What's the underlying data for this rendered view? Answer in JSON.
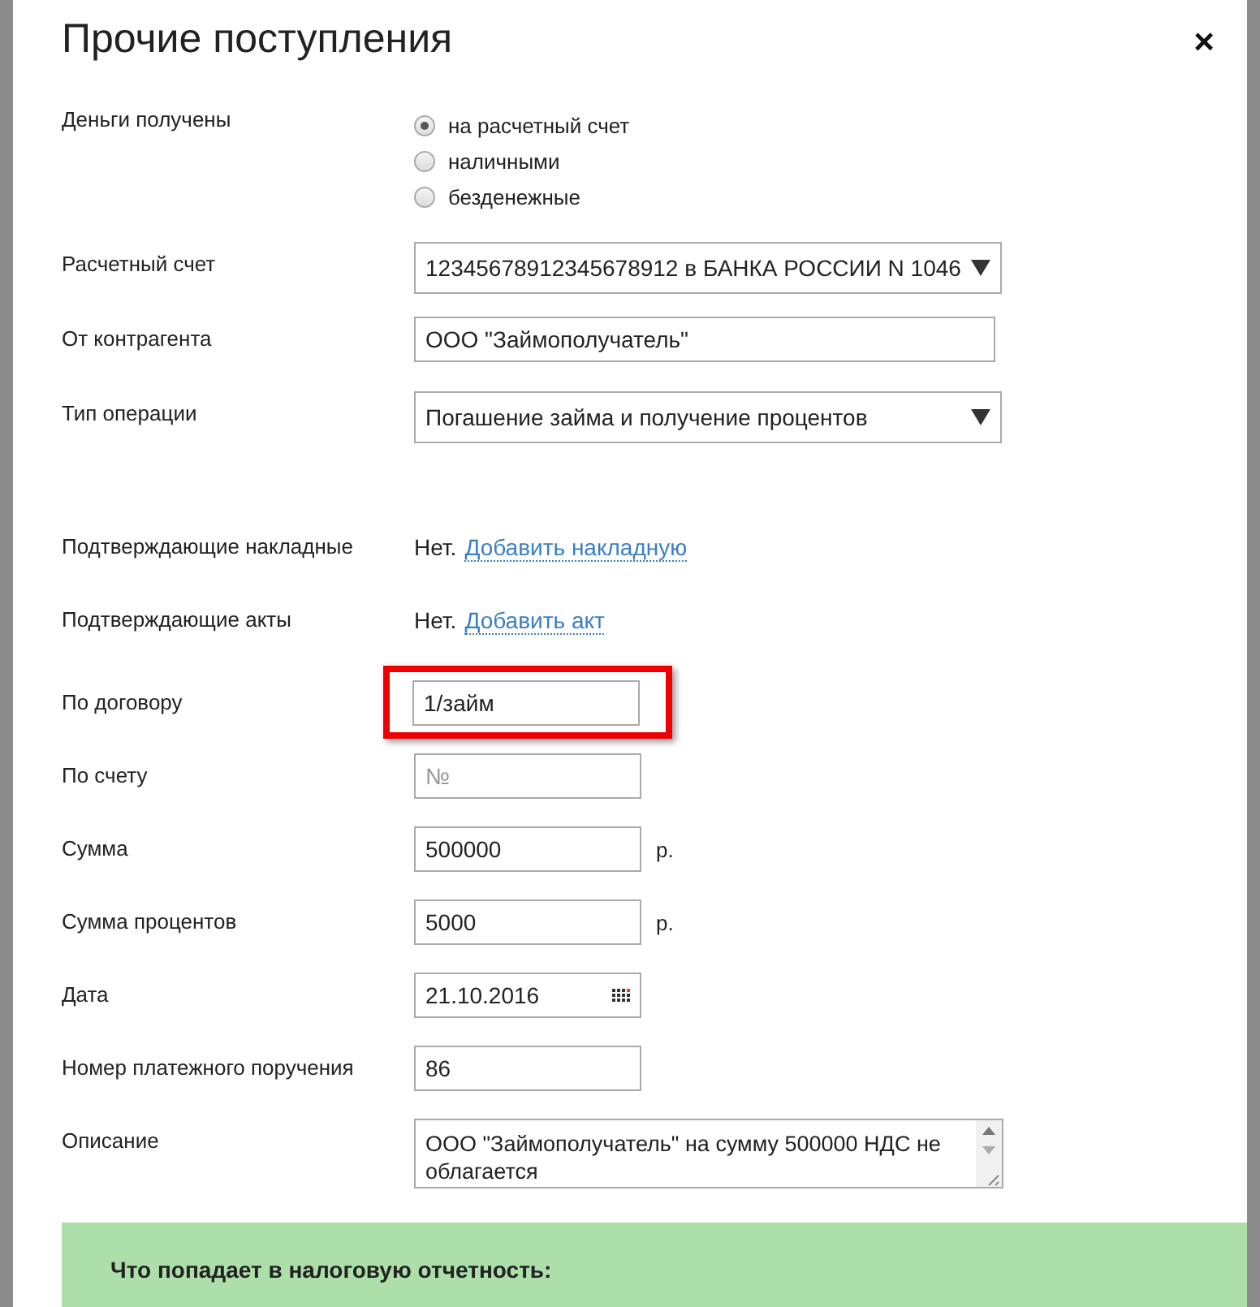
{
  "dialog": {
    "title": "Прочие поступления",
    "close": "×"
  },
  "fields": [
    {
      "kind": "radio",
      "label": "Деньги получены",
      "options": [
        {
          "label": "на расчетный счет",
          "selected": true
        },
        {
          "label": "наличными",
          "selected": false
        },
        {
          "label": "безденежные",
          "selected": false
        }
      ]
    },
    {
      "kind": "select",
      "label": "Расчетный счет",
      "value": "12345678912345678912 в БАНКА РОССИИ N 1046"
    },
    {
      "kind": "text",
      "label": "От контрагента",
      "value": "ООО \"Займополучатель\""
    },
    {
      "kind": "select",
      "label": "Тип операции",
      "value": "Погашение займа и получение процентов"
    },
    {
      "kind": "link",
      "label": "Подтверждающие накладные",
      "status": "Нет.",
      "link": "Добавить накладную"
    },
    {
      "kind": "link",
      "label": "Подтверждающие акты",
      "status": "Нет.",
      "link": "Добавить акт"
    },
    {
      "kind": "short",
      "label": "По договору",
      "value": "1/займ",
      "highlighted": true
    },
    {
      "kind": "short",
      "label": "По счету",
      "placeholder": "№"
    },
    {
      "kind": "short",
      "label": "Сумма",
      "value": "500000",
      "unit": "р."
    },
    {
      "kind": "short",
      "label": "Сумма процентов",
      "value": "5000",
      "unit": "р."
    },
    {
      "kind": "date",
      "label": "Дата",
      "value": "21.10.2016"
    },
    {
      "kind": "short",
      "label": "Номер платежного поручения",
      "value": "86"
    },
    {
      "kind": "textarea",
      "label": "Описание",
      "value": "ООО \"Займополучатель\" на сумму 500000 НДС не облагается"
    }
  ],
  "tax_section": {
    "title": "Что попадает в налоговую отчетность:"
  }
}
